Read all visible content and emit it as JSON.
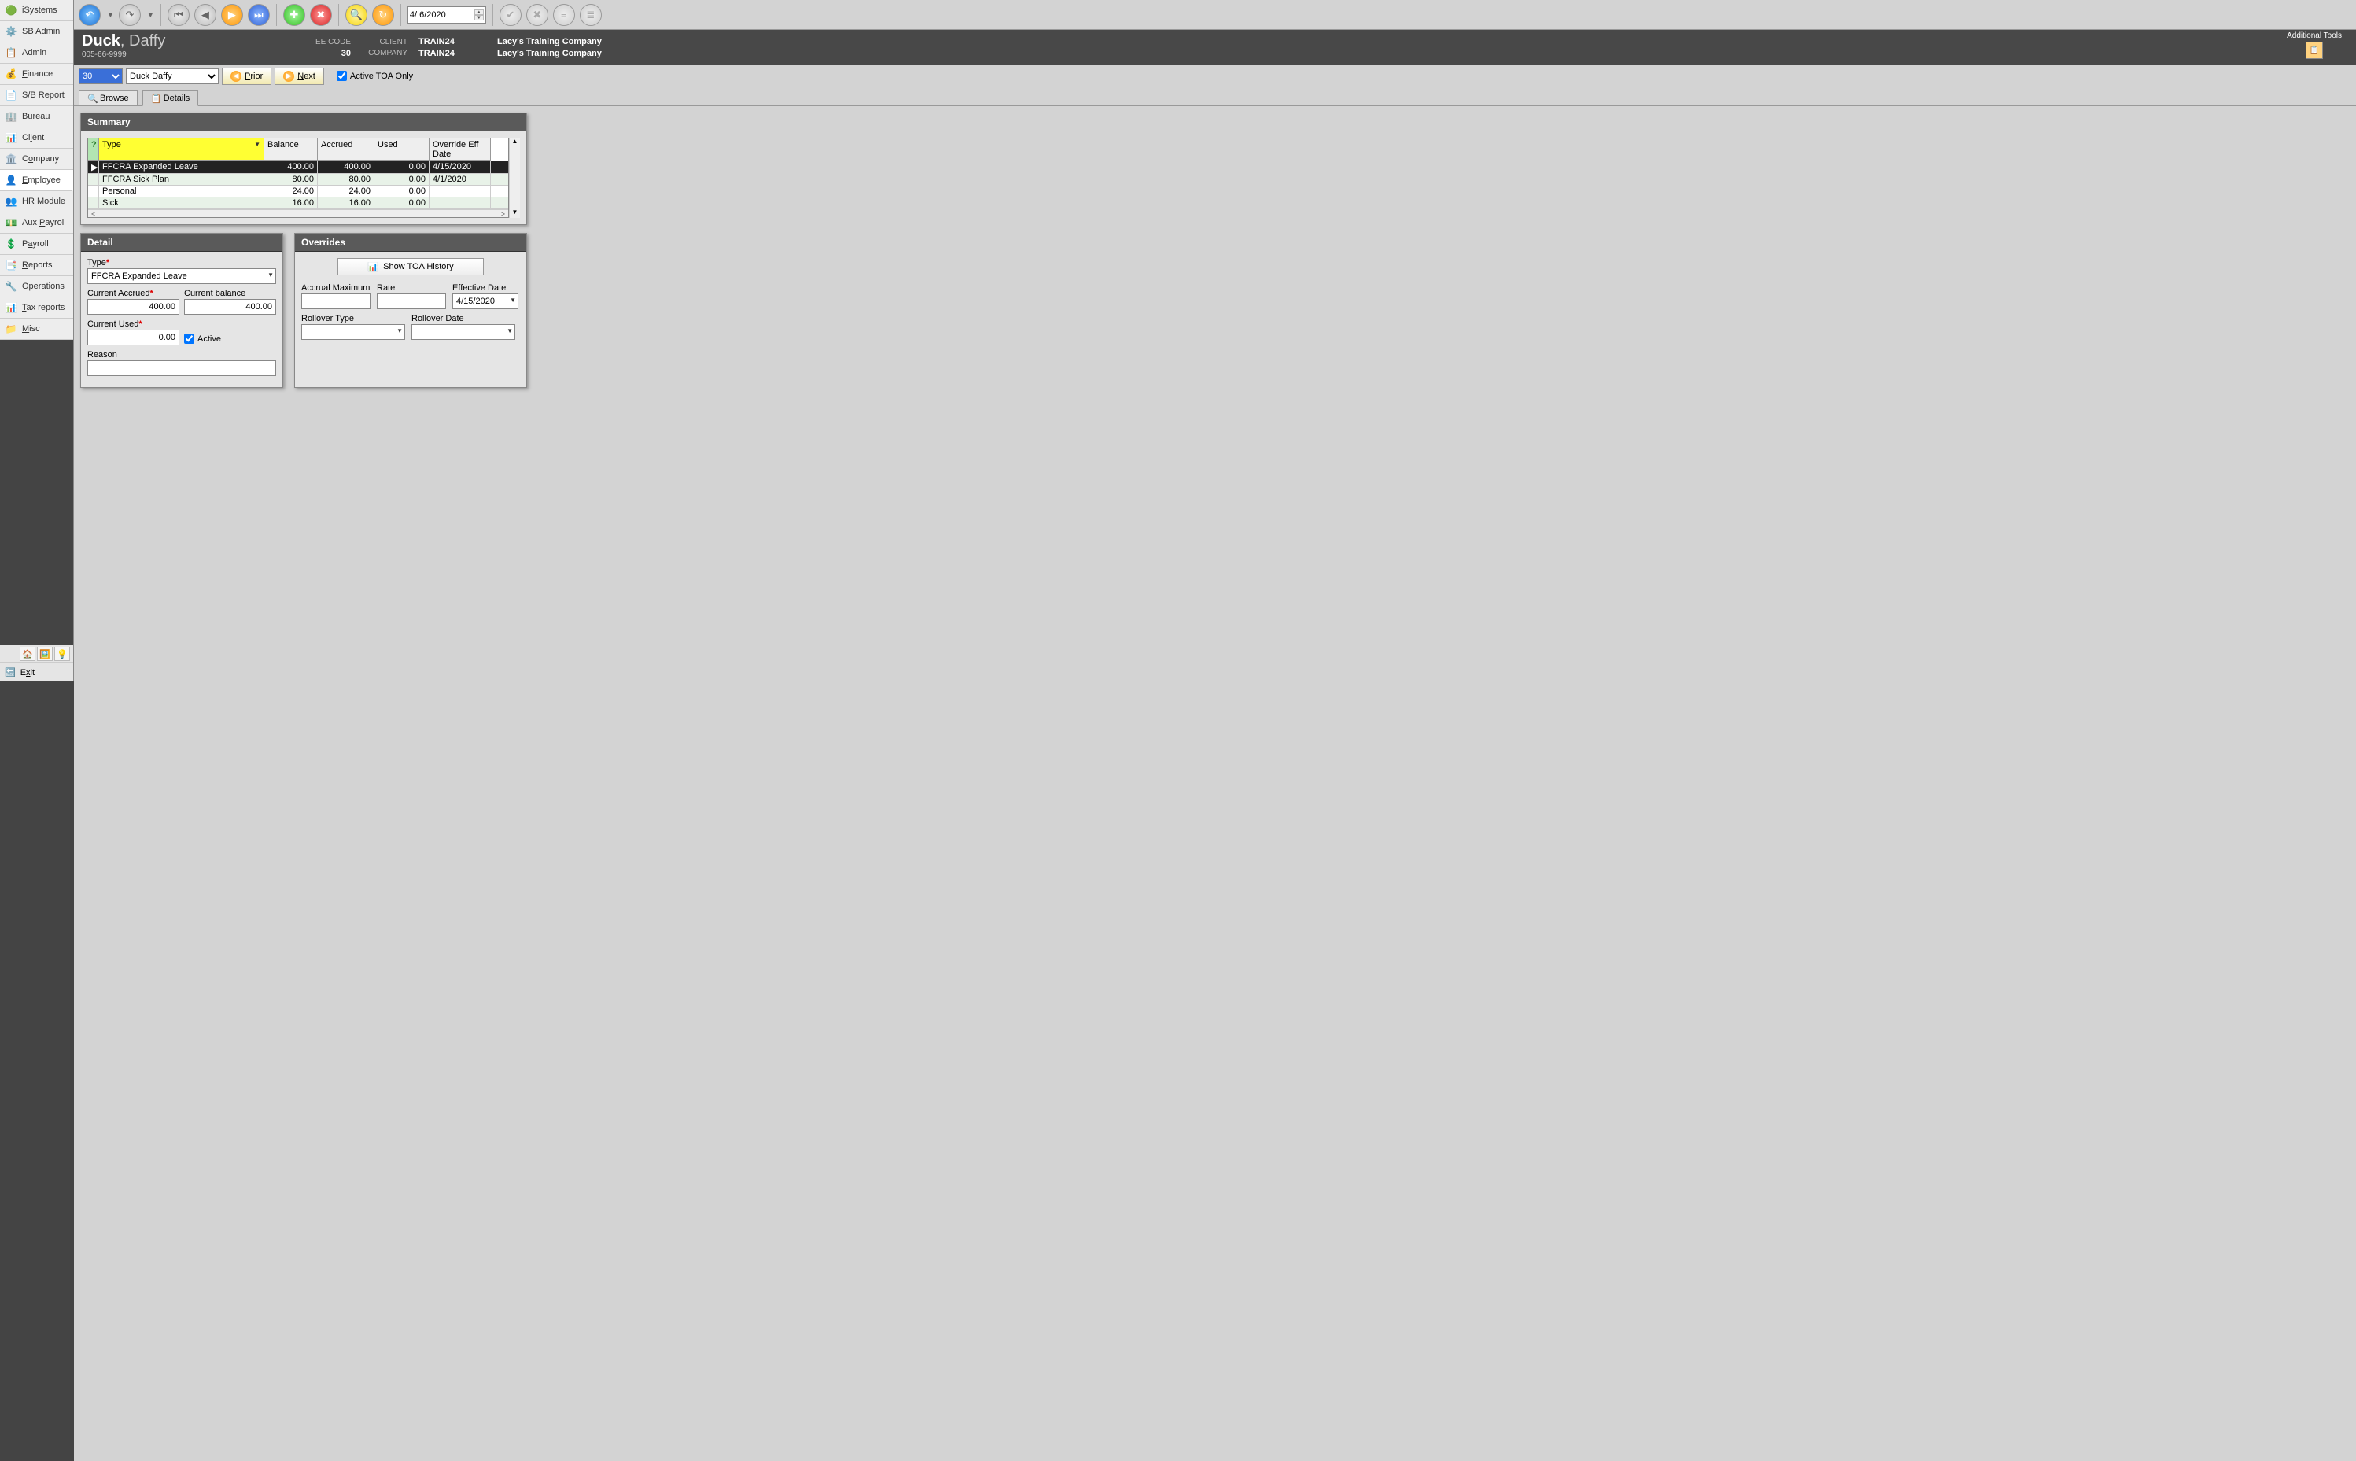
{
  "sidebar": {
    "items": [
      {
        "label": "iSystems",
        "icon": "🟢"
      },
      {
        "label": "SB Admin",
        "icon": "⚙️"
      },
      {
        "label": "Admin",
        "icon": "📋"
      },
      {
        "label": "Finance",
        "icon": "💰"
      },
      {
        "label": "S/B Report",
        "icon": "📄"
      },
      {
        "label": "Bureau",
        "icon": "🏢"
      },
      {
        "label": "Client",
        "icon": "📊"
      },
      {
        "label": "Company",
        "icon": "🏛️"
      },
      {
        "label": "Employee",
        "icon": "👤"
      },
      {
        "label": "HR Module",
        "icon": "👥"
      },
      {
        "label": "Aux Payroll",
        "icon": "💵"
      },
      {
        "label": "Payroll",
        "icon": "💲"
      },
      {
        "label": "Reports",
        "icon": "📑"
      },
      {
        "label": "Operations",
        "icon": "🔧"
      },
      {
        "label": "Tax reports",
        "icon": "📊"
      },
      {
        "label": "Misc",
        "icon": "📁"
      }
    ],
    "selected_index": 8,
    "exit_label": "Exit",
    "exit_icon": "🔙"
  },
  "toolbar": {
    "date_value": "4/ 6/2020"
  },
  "header": {
    "surname": "Duck",
    "firstname": "Daffy",
    "ssn": "005-66-9999",
    "labels": {
      "eecode": "EE CODE",
      "client": "CLIENT",
      "company": "COMPANY"
    },
    "eecode": "30",
    "client": "TRAIN24",
    "company": "TRAIN24",
    "client_name": "Lacy's Training Company",
    "company_name": "Lacy's Training Company",
    "tools_label": "Additional Tools"
  },
  "sub": {
    "id_value": "30",
    "name_value": "Duck Daffy",
    "prior_label": "Prior",
    "next_label": "Next",
    "checkbox_label": "Active TOA Only",
    "checkbox_checked": true
  },
  "tabs": {
    "browse": "Browse",
    "details": "Details"
  },
  "summary": {
    "title": "Summary",
    "columns": {
      "type": "Type",
      "balance": "Balance",
      "accrued": "Accrued",
      "used": "Used",
      "eff": "Override Eff Date"
    },
    "rows": [
      {
        "type": "FFCRA Expanded Leave",
        "balance": "400.00",
        "accrued": "400.00",
        "used": "0.00",
        "eff": "4/15/2020"
      },
      {
        "type": "FFCRA Sick Plan",
        "balance": "80.00",
        "accrued": "80.00",
        "used": "0.00",
        "eff": "4/1/2020"
      },
      {
        "type": "Personal",
        "balance": "24.00",
        "accrued": "24.00",
        "used": "0.00",
        "eff": ""
      },
      {
        "type": "Sick",
        "balance": "16.00",
        "accrued": "16.00",
        "used": "0.00",
        "eff": ""
      }
    ]
  },
  "detail": {
    "title": "Detail",
    "labels": {
      "type": "Type",
      "current_accrued": "Current Accrued",
      "current_balance": "Current balance",
      "current_used": "Current Used",
      "active": "Active",
      "reason": "Reason"
    },
    "values": {
      "type": "FFCRA Expanded Leave",
      "current_accrued": "400.00",
      "current_balance": "400.00",
      "current_used": "0.00",
      "active_checked": true,
      "reason": ""
    }
  },
  "overrides": {
    "title": "Overrides",
    "history_button": "Show TOA History",
    "labels": {
      "accrual_max": "Accrual Maximum",
      "rate": "Rate",
      "effective_date": "Effective Date",
      "rollover_type": "Rollover Type",
      "rollover_date": "Rollover Date"
    },
    "values": {
      "accrual_max": "",
      "rate": "",
      "effective_date": "4/15/2020",
      "rollover_type": "",
      "rollover_date": ""
    }
  }
}
